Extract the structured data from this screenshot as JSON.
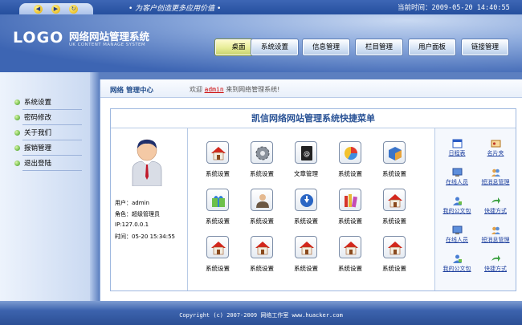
{
  "topbar": {
    "slogan": "• 为客户创造更多应用价值 •",
    "clock": "当前时间：2009-05-20 14:40:55",
    "nav_buttons": [
      "back",
      "forward",
      "refresh"
    ]
  },
  "header": {
    "logo": "LOGO",
    "title": "网络网站管理系统",
    "subtitle": "UK CONTENT MANAGE SYSTEM",
    "tabs": [
      {
        "label": "桌面",
        "active": true
      },
      {
        "label": "系统设置",
        "active": false
      },
      {
        "label": "信息管理",
        "active": false
      },
      {
        "label": "栏目管理",
        "active": false
      },
      {
        "label": "用户面板",
        "active": false
      },
      {
        "label": "链接管理",
        "active": false
      }
    ]
  },
  "sidebar": {
    "items": [
      {
        "label": "系统设置"
      },
      {
        "label": "密码修改"
      },
      {
        "label": "关于我们"
      },
      {
        "label": "报销管理"
      },
      {
        "label": "退出登陆"
      }
    ]
  },
  "main": {
    "breadcrumb": "网络  管理中心",
    "welcome_pre": "欢迎",
    "welcome_user": "admin",
    "welcome_post": "来到网络管理系统!",
    "panel_title": "凯信网络网站管理系统快捷菜单",
    "user": {
      "user": "用户：admin",
      "role": "角色：超级管理员",
      "ip": "IP:127.0.0.1",
      "time": "时间：05-20 15:34:55"
    },
    "tiles": [
      {
        "label": "系统设置",
        "icon": "home-icon"
      },
      {
        "label": "系统设置",
        "icon": "gear-icon"
      },
      {
        "label": "文章管理",
        "icon": "book-icon"
      },
      {
        "label": "系统设置",
        "icon": "chart-icon"
      },
      {
        "label": "系统设置",
        "icon": "box-icon"
      },
      {
        "label": "系统设置",
        "icon": "gift-icon"
      },
      {
        "label": "系统设置",
        "icon": "user-icon"
      },
      {
        "label": "系统设置",
        "icon": "download-icon"
      },
      {
        "label": "系统设置",
        "icon": "books-icon"
      },
      {
        "label": "系统设置",
        "icon": "home-icon"
      },
      {
        "label": "系统设置",
        "icon": "home-icon"
      },
      {
        "label": "系统设置",
        "icon": "home-icon"
      },
      {
        "label": "系统设置",
        "icon": "home-icon"
      },
      {
        "label": "系统设置",
        "icon": "home-icon"
      },
      {
        "label": "系统设置",
        "icon": "home-icon"
      }
    ],
    "quick_links": [
      {
        "label": "日程表",
        "icon": "calendar-icon"
      },
      {
        "label": "名片夹",
        "icon": "card-icon"
      },
      {
        "label": "在线人员",
        "icon": "online-users-icon"
      },
      {
        "label": "短消息管理",
        "icon": "message-icon"
      },
      {
        "label": "我的公文包",
        "icon": "briefcase-icon"
      },
      {
        "label": "快捷方式",
        "icon": "shortcut-icon"
      },
      {
        "label": "在线人员",
        "icon": "online-users-icon"
      },
      {
        "label": "短消息管理",
        "icon": "message-icon"
      },
      {
        "label": "我的公文包",
        "icon": "briefcase-icon"
      },
      {
        "label": "快捷方式",
        "icon": "shortcut-icon"
      }
    ]
  },
  "footer": {
    "copyright": "Copyright (c) 2007-2009 网络工作室 www.huacker.com"
  },
  "colors": {
    "accent": "#2a5396",
    "header_blue": "#3d65b3",
    "active_tab": "#e6ec96",
    "link": "#1d3f9e",
    "username": "#cc0000"
  }
}
